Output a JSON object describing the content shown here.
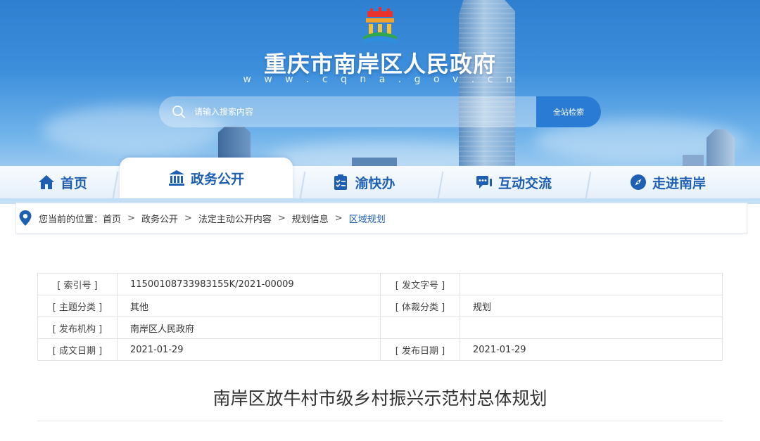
{
  "site": {
    "title": "重庆市南岸区人民政府",
    "url": "w w w . c q n a . g o v . c n"
  },
  "search": {
    "placeholder": "请输入搜索内容",
    "button_label": "全站检索"
  },
  "nav": {
    "tabs": [
      {
        "label": "首页",
        "icon": "home-icon",
        "active": false
      },
      {
        "label": "政务公开",
        "icon": "government-building-icon",
        "active": true
      },
      {
        "label": "渝快办",
        "icon": "clipboard-icon",
        "active": false
      },
      {
        "label": "互动交流",
        "icon": "chat-bubble-icon",
        "active": false
      },
      {
        "label": "走进南岸",
        "icon": "compass-icon",
        "active": false
      }
    ]
  },
  "breadcrumb": {
    "prefix": "您当前的位置：",
    "items": [
      "首页",
      "政务公开",
      "法定主动公开内容",
      "规划信息"
    ],
    "current": "区域规划",
    "separator": ">"
  },
  "info_table": {
    "rows": [
      {
        "k1": "[ 索引号 ]",
        "v1": "11500108733983155K/2021-00009",
        "k2": "[ 发文字号 ]",
        "v2": ""
      },
      {
        "k1": "[ 主题分类 ]",
        "v1": "其他",
        "k2": "[ 体裁分类 ]",
        "v2": "规划"
      },
      {
        "k1": "[ 发布机构 ]",
        "v1": "南岸区人民政府",
        "k2": "",
        "v2": ""
      },
      {
        "k1": "[ 成文日期 ]",
        "v1": "2021-01-29",
        "k2": "[ 发布日期 ]",
        "v2": "2021-01-29"
      }
    ]
  },
  "document": {
    "title": "南岸区放牛村市级乡村振兴示范村总体规划"
  },
  "colors": {
    "brand_blue": "#1f5fb2",
    "search_button": "#2a7bd4"
  }
}
